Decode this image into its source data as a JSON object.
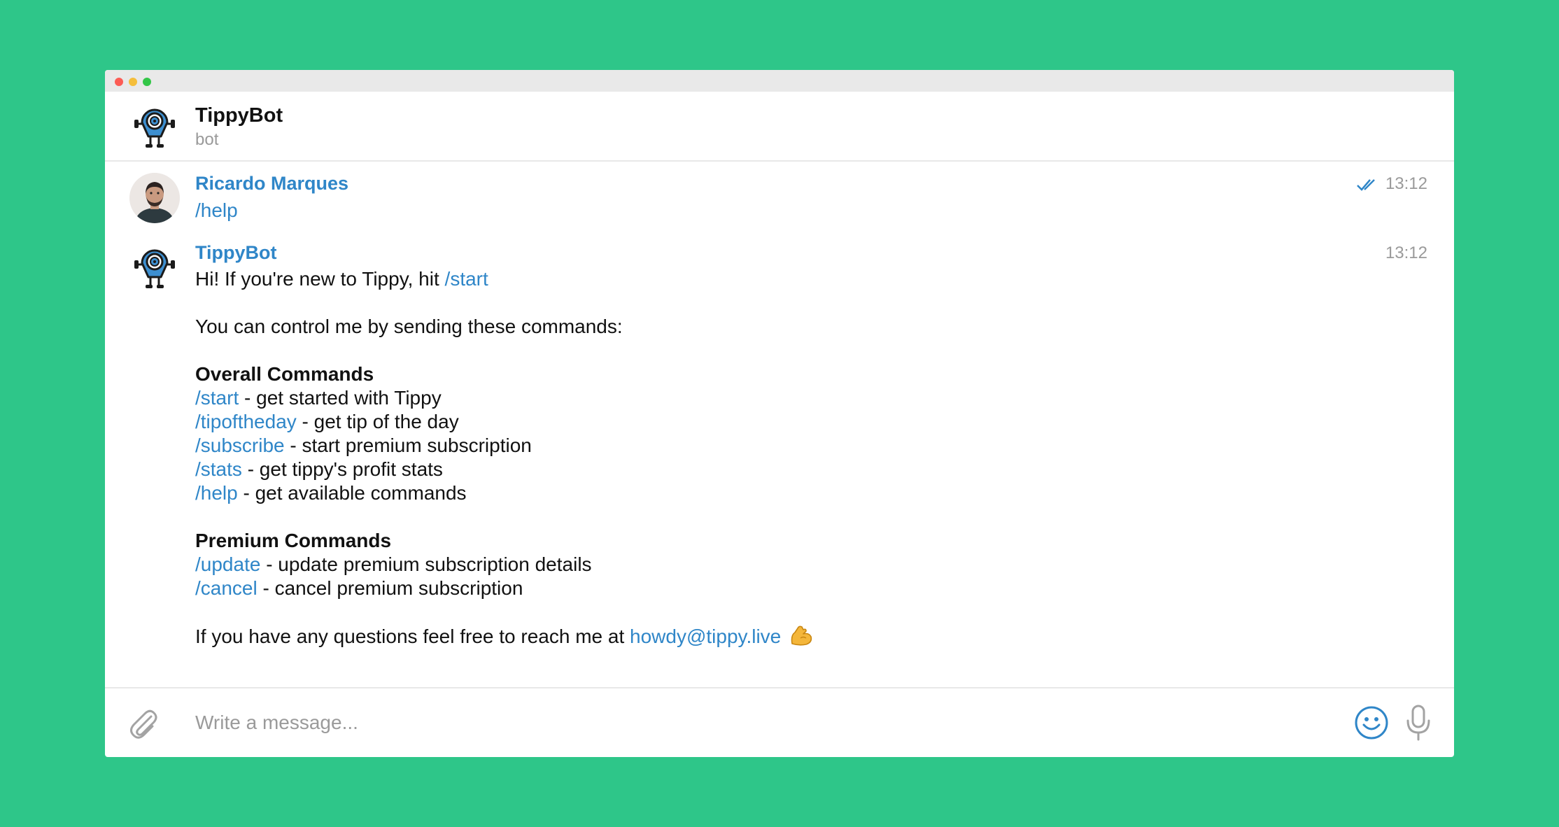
{
  "window": {
    "title_bar_buttons": [
      "close",
      "minimize",
      "zoom"
    ]
  },
  "header": {
    "title": "TippyBot",
    "subtitle": "bot",
    "avatar_icon": "robot-icon"
  },
  "messages": [
    {
      "sender": "Ricardo Marques",
      "time": "13:12",
      "status": "read",
      "text": "/help"
    },
    {
      "sender": "TippyBot",
      "time": "13:12",
      "intro_text": "Hi! If you're new to Tippy, hit ",
      "intro_link": "/start",
      "control_text": "You can control me by sending these commands:",
      "overall_heading": "Overall Commands",
      "overall_commands": [
        {
          "cmd": "/start",
          "desc": " - get started with Tippy"
        },
        {
          "cmd": "/tipoftheday",
          "desc": " - get tip of the day"
        },
        {
          "cmd": "/subscribe",
          "desc": " - start premium subscription"
        },
        {
          "cmd": "/stats",
          "desc": " - get tippy's profit stats"
        },
        {
          "cmd": "/help",
          "desc": " - get available commands"
        }
      ],
      "premium_heading": "Premium Commands",
      "premium_commands": [
        {
          "cmd": "/update",
          "desc": " - update premium subscription details"
        },
        {
          "cmd": "/cancel",
          "desc": " - cancel premium subscription"
        }
      ],
      "outro_text": "If you have any questions feel free to reach me at ",
      "outro_link": "howdy@tippy.live",
      "outro_emoji": "💪"
    }
  ],
  "composer": {
    "placeholder": "Write a message...",
    "attach_icon": "paperclip-icon",
    "emoji_icon": "smiley-icon",
    "mic_icon": "microphone-icon"
  },
  "colors": {
    "background": "#2ec689",
    "accent": "#2f86c8",
    "muted": "#9a9a9a"
  }
}
